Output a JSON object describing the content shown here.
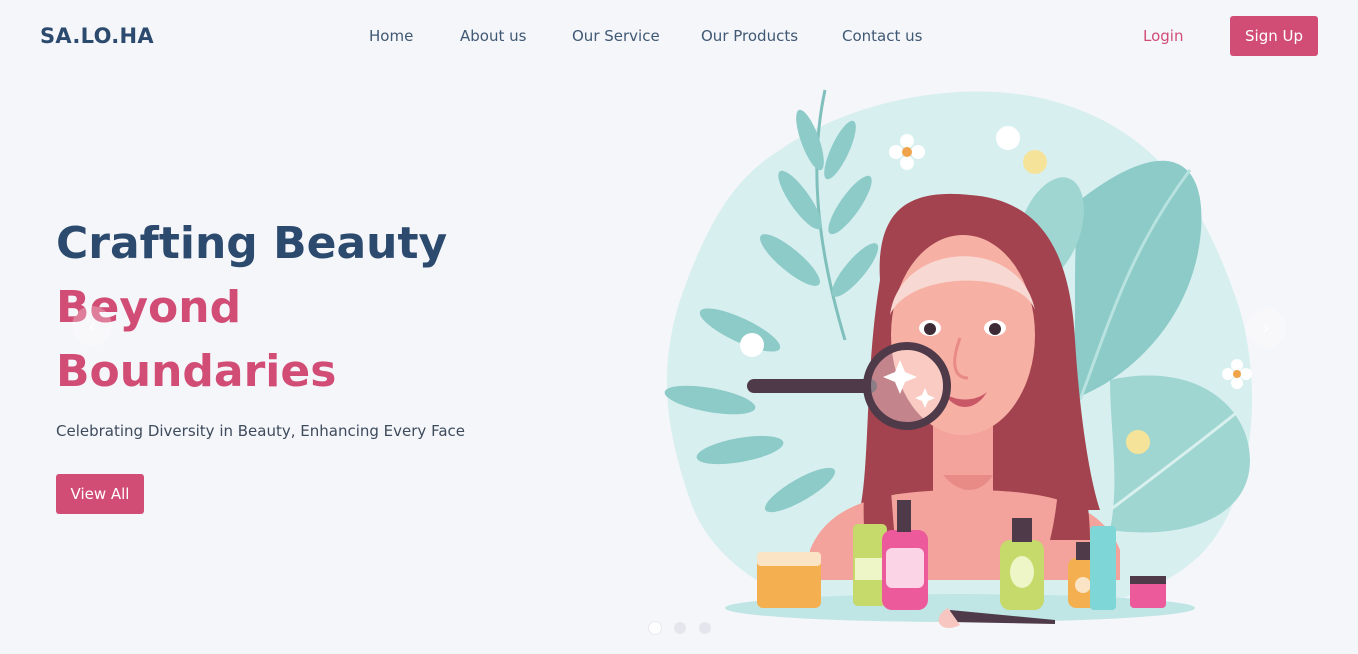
{
  "header": {
    "brand": "SA.LO.HA",
    "nav": [
      {
        "label": "Home"
      },
      {
        "label": "About us"
      },
      {
        "label": "Our Service"
      },
      {
        "label": "Our Products"
      },
      {
        "label": "Contact us"
      }
    ],
    "login_label": "Login",
    "signup_label": "Sign Up"
  },
  "hero": {
    "title_line1": "Crafting Beauty",
    "title_line2": "Beyond",
    "title_line3": "Boundaries",
    "subtitle": "Celebrating Diversity in Beauty, Enhancing Every Face",
    "cta_label": "View All"
  },
  "carousel": {
    "prev_icon": "chevron-left-icon",
    "next_icon": "chevron-right-icon",
    "dot_count": 3,
    "active_dot": 1
  },
  "colors": {
    "primary": "#d14d75",
    "navy": "#2b4a6d",
    "background": "#f5f6fa",
    "blob": "#d8eff0",
    "leaf": "#8ccbc8"
  }
}
